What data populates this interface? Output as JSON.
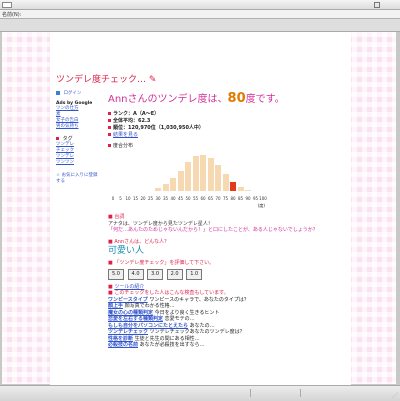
{
  "browser": {
    "address_label": "名前(N):",
    "status_text": ""
  },
  "header": {
    "title": "ツンデレ度チェック…",
    "pen_glyph": "✎"
  },
  "sidebar": {
    "login": "ログイン",
    "ads": "Ads by Google",
    "links": [
      "ツンの仕方",
      "素",
      "女子の告白",
      "男の気持ち"
    ],
    "tag_head": "タグ",
    "tags": [
      "ツンデレ",
      "チェック",
      "ツンデレ",
      "ツンツン"
    ],
    "bookmark": "お気に入りに登録する"
  },
  "main": {
    "result_prefix": "Annさんのツンデレ度は、",
    "score": "80",
    "result_suffix": "度です。",
    "rank": "ランク：A（A〜E）",
    "avg": "全体平均：62.3",
    "position": "順位：120,970位（1,030,950人中）",
    "retry": "結果を見る",
    "dist_title": "度合分布",
    "quote_head": "台詞",
    "quote_text1": "アナタは、ツンデレ度から見たツンデレ星人！",
    "quote_text2": "「何だ…あんたのためじゃないんだから！」と口にしたことが、ある人じゃないでしょうか？",
    "comment_head": "Annさんは、どんな人？",
    "kawaii": "可愛い人",
    "evaluate": "「ツンデレ度チェック」を評価して下さい。",
    "rating_buttons": [
      "5.0",
      "4.0",
      "3.0",
      "2.0",
      "1.0"
    ],
    "other_head": "ツールの紹介",
    "other_sub": "このチェックをした人はこんな検査もしています。",
    "others": [
      {
        "name": "ワンピースタイプ",
        "desc": "ワンピースのキャラで、あなたのタイプは？"
      },
      {
        "name": "顔上手",
        "desc": "顔写真でわかる性格…"
      },
      {
        "name": "魔女の心の種類判定",
        "desc": "今日をより良く生きるヒント"
      },
      {
        "name": "恋愛を左右する種類判定",
        "desc": "恋愛モテの…"
      },
      {
        "name": "もしも自分をパソコンにたとえたら",
        "desc": "あなたの…"
      },
      {
        "name": "ツンデレチェック",
        "desc": "ツンデレチェックあなたのツンデレ度は？"
      },
      {
        "name": "性格を診断",
        "desc": "生徒と先生の間にある相性…"
      },
      {
        "name": "必殺技の名前",
        "desc": "あなたが必殺技を出すなら…"
      }
    ]
  },
  "chart_data": {
    "type": "bar",
    "categories": [
      "0",
      "5",
      "10",
      "15",
      "20",
      "25",
      "30",
      "35",
      "40",
      "45",
      "50",
      "55",
      "60",
      "65",
      "70",
      "75",
      "80",
      "85",
      "90",
      "95",
      "100"
    ],
    "values": [
      0,
      0,
      0,
      0,
      0,
      0,
      2,
      5,
      9,
      14,
      20,
      24,
      25,
      23,
      18,
      12,
      6,
      3,
      1,
      0,
      0
    ],
    "highlight_category": "80",
    "xlabel": "(度)",
    "colors": {
      "bar": "#f6d9b0",
      "highlight": "#e23a1a"
    }
  }
}
